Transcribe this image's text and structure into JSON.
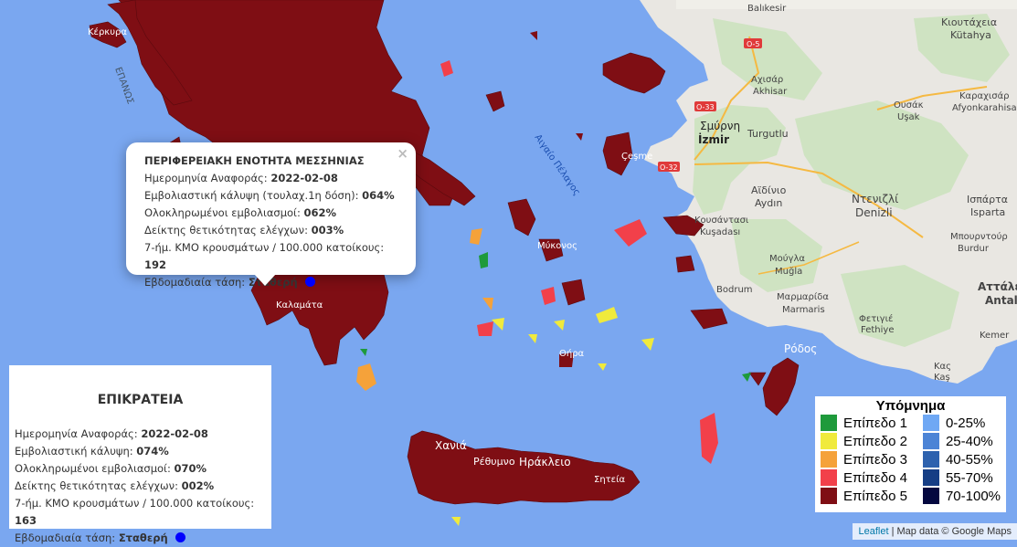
{
  "popup": {
    "title": "ΠΕΡΙΦΕΡΕΙΑΚΗ ΕΝΟΤΗΤΑ ΜΕΣΣΗΝΙΑΣ",
    "close_symbol": "×",
    "date_label": "Ημερομηνία Αναφοράς:",
    "date_value": "2022-02-08",
    "coverage_label": "Εμβολιαστική κάλυψη (τουλαχ.1η δόση):",
    "coverage_value": "064%",
    "full_label": "Ολοκληρωμένοι εμβολιασμοί:",
    "full_value": "062%",
    "positivity_label": "Δείκτης θετικότητας ελέγχων:",
    "positivity_value": "003%",
    "cases_label": "7-ήμ. ΚΜΟ κρουσμάτων / 100.000 κατοίκους:",
    "cases_value": "192",
    "trend_label": "Εβδομαδιαία τάση:",
    "trend_value": "Σταθερή",
    "trend_color": "#0000ff"
  },
  "national": {
    "title": "ΕΠΙΚΡΑΤΕΙΑ",
    "date_label": "Ημερομηνία Αναφοράς:",
    "date_value": "2022-02-08",
    "coverage_label": "Εμβολιαστική κάλυψη:",
    "coverage_value": "074%",
    "full_label": "Ολοκληρωμένοι εμβολιασμοί:",
    "full_value": "070%",
    "positivity_label": "Δείκτης θετικότητας ελέγχων:",
    "positivity_value": "002%",
    "cases_label": "7-ήμ. ΚΜΟ κρουσμάτων / 100.000 κατοίκους:",
    "cases_value": "163",
    "trend_label": "Εβδομαδιαία τάση:",
    "trend_value": "Σταθερή",
    "trend_color": "#0000ff"
  },
  "legend": {
    "title": "Υπόμνημα",
    "levels": [
      {
        "label": "Επίπεδο 1",
        "color": "#1e9a3b"
      },
      {
        "label": "Επίπεδο 2",
        "color": "#f0ea3c"
      },
      {
        "label": "Επίπεδο 3",
        "color": "#f5a23a"
      },
      {
        "label": "Επίπεδο 4",
        "color": "#f2404a"
      },
      {
        "label": "Επίπεδο 5",
        "color": "#7f0e14"
      }
    ],
    "coverage": [
      {
        "label": "0-25%",
        "color": "#6fa8f4"
      },
      {
        "label": "25-40%",
        "color": "#4c84d6"
      },
      {
        "label": "40-55%",
        "color": "#2e62ae"
      },
      {
        "label": "55-70%",
        "color": "#163e85"
      },
      {
        "label": "70-100%",
        "color": "#04083f"
      }
    ]
  },
  "map_labels": {
    "kerkyra": "Κέρκυρα",
    "epanos": "ΕΠΑΝΩΣ",
    "aigaio": "Αιγαίο Πέλαγος",
    "mykonos": "Μύκονος",
    "thira": "Θήρα",
    "chania": "Χανιά",
    "rethymno": "Ρέθυμνο",
    "irakleio": "Ηράκλειο",
    "sitia": "Σητεία",
    "rodos": "Ρόδος",
    "kalamata": "Καλαμάτα",
    "chesme": "Çeşme",
    "smyrni": "Σμύρνη",
    "izmir": "İzmir",
    "turgutlu": "Turgutlu",
    "aidinio": "Αϊδίνιο",
    "aydin": "Aydın",
    "ntenizli": "Ντενιζλί",
    "denizli": "Denizli",
    "kousantasi": "Κουσάντασι",
    "kusadasi": "Kuşadası",
    "mougla": "Μούγλα",
    "mugla": "Muğla",
    "marmaris_gr": "Μαρμαρίδα",
    "marmaris": "Marmaris",
    "fethiye_gr": "Φετιγιέ",
    "fethiye": "Fethiye",
    "bodrum": "Bodrum",
    "akhisar_gr": "Αχισάρ",
    "akhisar": "Akhisar",
    "kutahya_gr": "Κιουτάχεια",
    "kutahya": "Kütahya",
    "balikesir": "Balıkesir",
    "usak_gr": "Ουσάκ",
    "usak": "Uşak",
    "karahisar_gr": "Καραχισάρ",
    "afyon": "Afyonkarahisa",
    "isparta_gr": "Ισπάρτα",
    "isparta": "Isparta",
    "burdur_gr": "Μπουρντούρ",
    "burdur": "Burdur",
    "attaleia": "Αττάλεια",
    "antalya": "Antal",
    "kemer": "Kemer",
    "kas_gr": "Κας",
    "kas": "Kaş",
    "road_o5": "O-5",
    "road_o33": "O-33",
    "road_o32": "O-32"
  },
  "attribution": {
    "leaflet": "Leaflet",
    "separator": "|",
    "mapdata": "Map data © Google Maps"
  }
}
